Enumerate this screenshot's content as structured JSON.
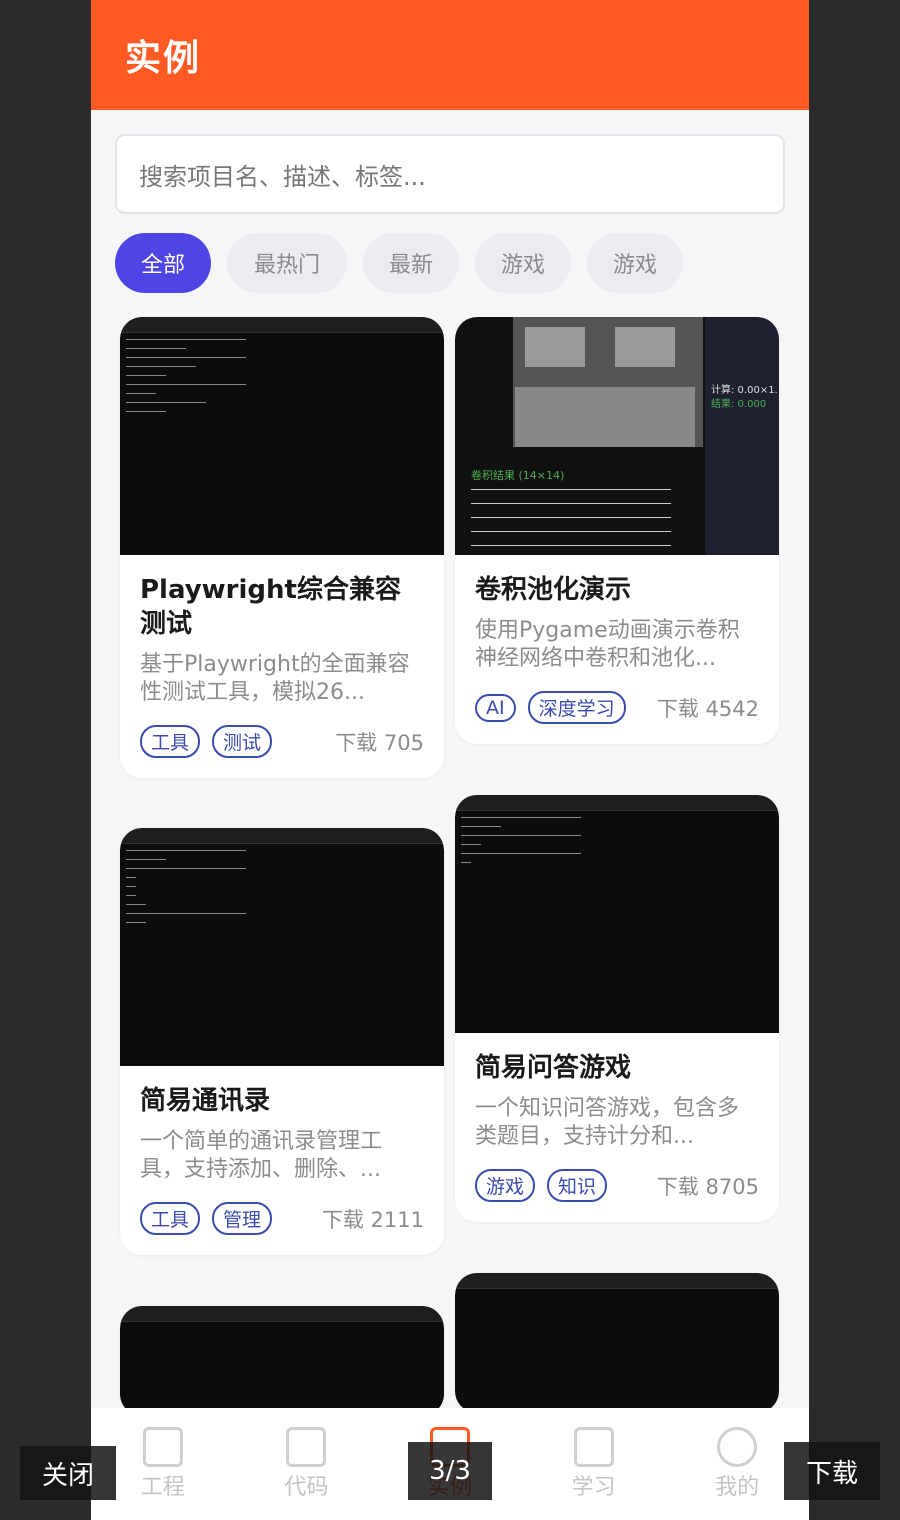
{
  "header": {
    "title": "实例"
  },
  "search": {
    "placeholder": "搜索项目名、描述、标签..."
  },
  "chips": [
    "全部",
    "最热门",
    "最新",
    "游戏",
    "游戏"
  ],
  "cards": [
    {
      "title": "Playwright综合兼容测试",
      "desc": "基于Playwright的全面兼容性测试工具，模拟26...",
      "tags": [
        "工具",
        "测试"
      ],
      "downloads": "下载 705"
    },
    {
      "title": "卷积池化演示",
      "desc": "使用Pygame动画演示卷积神经网络中卷积和池化...",
      "tags": [
        "AI",
        "深度学习"
      ],
      "downloads": "下载 4542"
    },
    {
      "title": "简易通讯录",
      "desc": "一个简单的通讯录管理工具，支持添加、删除、...",
      "tags": [
        "工具",
        "管理"
      ],
      "downloads": "下载 2111"
    },
    {
      "title": "简易问答游戏",
      "desc": "一个知识问答游戏，包含多类题目，支持计分和...",
      "tags": [
        "游戏",
        "知识"
      ],
      "downloads": "下载 8705"
    }
  ],
  "conv": {
    "label": "卷积结果 (14×14)",
    "calc": "计算: 0.00×1.",
    "result": "结果: 0.000"
  },
  "tabbar": [
    {
      "label": "工程",
      "icon": "project-icon"
    },
    {
      "label": "代码",
      "icon": "code-icon"
    },
    {
      "label": "实例",
      "icon": "examples-icon"
    },
    {
      "label": "学习",
      "icon": "books-icon"
    },
    {
      "label": "我的",
      "icon": "user-icon"
    }
  ],
  "overlay": {
    "close": "关闭",
    "page": "3/3",
    "download": "下载"
  },
  "colors": {
    "accent": "#ff5a24",
    "chip_active": "#4f45e4",
    "tag": "#3b4bb0"
  }
}
